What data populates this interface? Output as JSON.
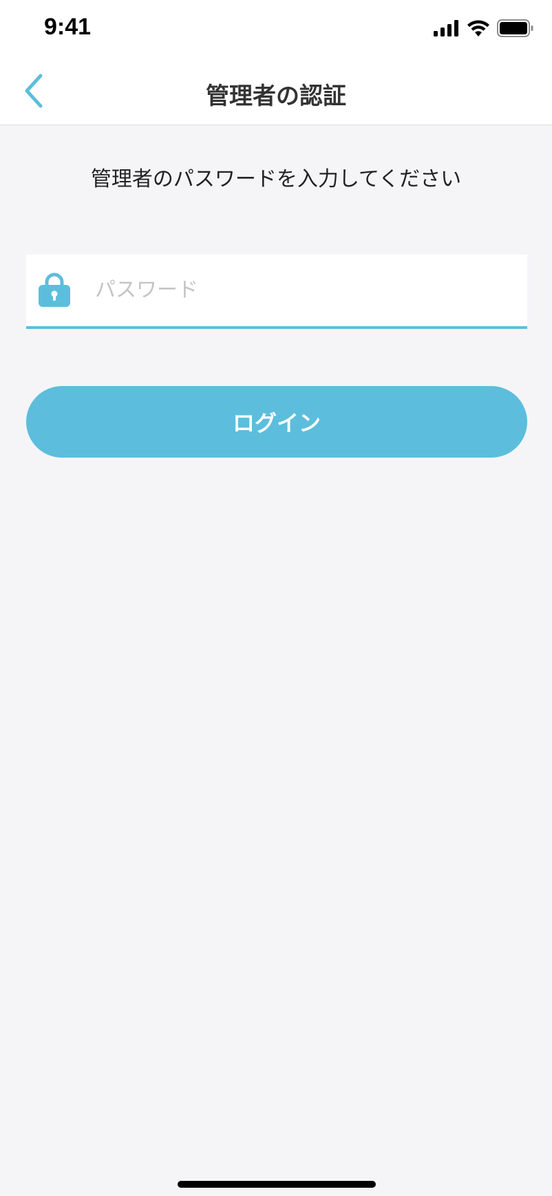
{
  "status_bar": {
    "time": "9:41",
    "icons": [
      "signal-icon",
      "wifi-icon",
      "battery-icon"
    ]
  },
  "nav": {
    "title": "管理者の認証",
    "back_icon": "chevron-left-icon"
  },
  "main": {
    "instruction": "管理者のパスワードを入力してください",
    "password": {
      "icon": "lock-icon",
      "placeholder": "パスワード",
      "value": ""
    },
    "login_label": "ログイン"
  },
  "colors": {
    "accent": "#5cbedc",
    "background": "#f5f5f8",
    "title_text": "#333333",
    "placeholder": "#c4c4c8"
  }
}
